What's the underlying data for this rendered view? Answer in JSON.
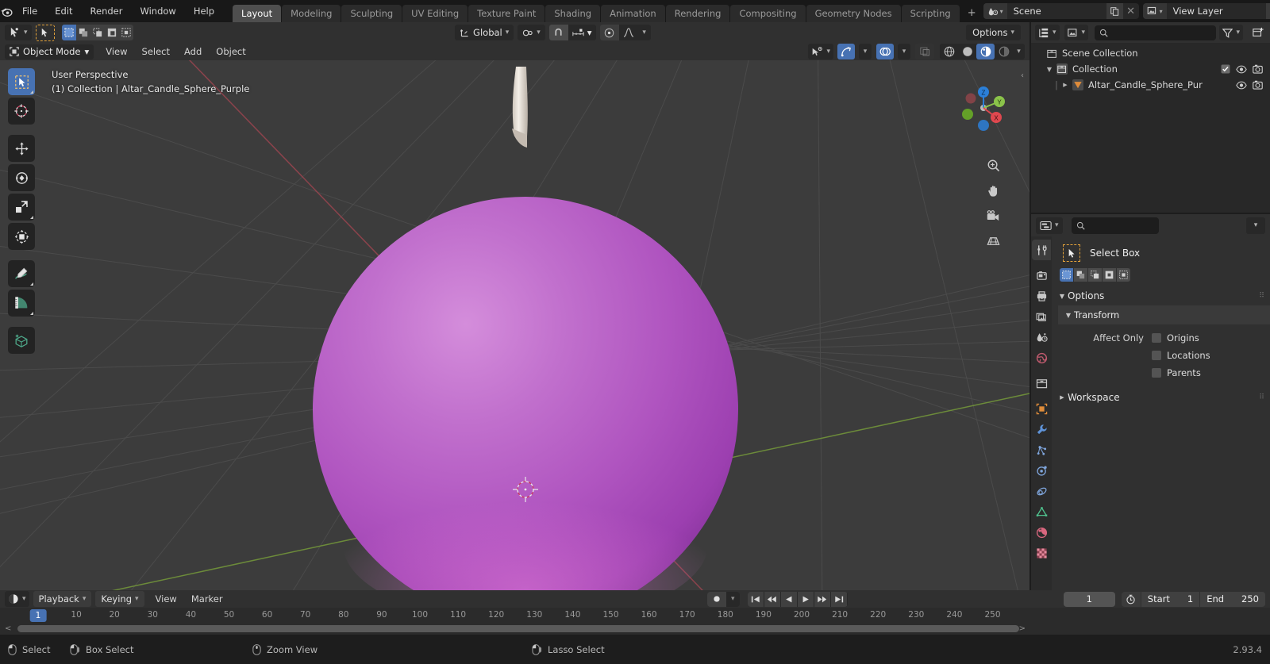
{
  "app": {
    "title": "Blender",
    "version": "2.93.4",
    "logo_icon": "blender-logo-icon"
  },
  "topbar": {
    "menus": [
      "File",
      "Edit",
      "Render",
      "Window",
      "Help"
    ],
    "workspace_tabs": [
      "Layout",
      "Modeling",
      "Sculpting",
      "UV Editing",
      "Texture Paint",
      "Shading",
      "Animation",
      "Rendering",
      "Compositing",
      "Geometry Nodes",
      "Scripting"
    ],
    "active_workspace": "Layout",
    "add_workspace_label": "+",
    "scene": {
      "icon": "scene-icon",
      "name": "Scene",
      "new_icon": "new-copy-icon",
      "unlink_icon": "close-x-icon"
    },
    "view_layer": {
      "icon": "view-layer-icon",
      "name": "View Layer",
      "new_icon": "new-copy-icon",
      "unlink_icon": "close-x-icon"
    }
  },
  "viewport_toolsettings": {
    "active_tool_icon": "cursor-tool-icon",
    "select_mode_icons": [
      "select-new-icon",
      "select-extend-icon",
      "select-subtract-icon",
      "select-invert-icon",
      "select-intersect-icon"
    ],
    "transform_orientation": {
      "icon": "orientation-icon",
      "value": "Global",
      "chevron": "v"
    },
    "pivot_point": {
      "icon": "pivot-icon",
      "chevron": "v"
    },
    "snap_magnet_icon": "magnet-icon",
    "snap_target": {
      "icon": "snap-increment-icon",
      "chevron": "v"
    },
    "proportional_edit_icon": "proportional-edit-icon",
    "falloff_icon": "falloff-curve-icon",
    "options_label": "Options",
    "options_chevron": "v"
  },
  "viewport_header": {
    "mode": {
      "icon": "object-mode-icon",
      "label": "Object Mode",
      "chevron": "v"
    },
    "menus": [
      "View",
      "Select",
      "Add",
      "Object"
    ],
    "right_controls": {
      "visibility": {
        "icon": "visibility-icon",
        "chevron": "v"
      },
      "gizmo": {
        "icon": "gizmo-icon",
        "chevron": "v",
        "active": true
      },
      "overlays": {
        "icon": "overlays-icon",
        "chevron": "v",
        "active": true
      },
      "xray_icon": "xray-icon",
      "shading_modes": [
        "wireframe-icon",
        "solid-icon",
        "material-preview-icon",
        "rendered-icon"
      ],
      "shading_active_index": 2,
      "shading_chevron": "v"
    }
  },
  "viewport": {
    "overlay_line1": "User Perspective",
    "overlay_line2": "(1) Collection | Altar_Candle_Sphere_Purple",
    "toolbar": [
      {
        "name": "tweak-select-box-tool",
        "icon": "select-box-icon",
        "selected": true
      },
      {
        "name": "cursor-tool",
        "icon": "cursor-3d-icon",
        "selected": false
      },
      {
        "name": "move-tool",
        "icon": "move-icon",
        "selected": false
      },
      {
        "name": "rotate-tool",
        "icon": "rotate-icon",
        "selected": false
      },
      {
        "name": "scale-tool",
        "icon": "scale-icon",
        "selected": false
      },
      {
        "name": "transform-tool",
        "icon": "transform-icon",
        "selected": false
      },
      {
        "name": "annotate-tool",
        "icon": "annotate-pencil-icon",
        "selected": false
      },
      {
        "name": "measure-tool",
        "icon": "measure-ruler-icon",
        "selected": false
      },
      {
        "name": "add-cube-tool",
        "icon": "add-cube-icon",
        "selected": false
      }
    ],
    "gizmo_axes": [
      {
        "label": "Z",
        "color": "#2b7fd8"
      },
      {
        "label": "Y",
        "color": "#8bc34a"
      },
      {
        "label": "X",
        "color": "#e0484f"
      }
    ],
    "nav_buttons": [
      "zoom-icon",
      "pan-hand-icon",
      "camera-icon",
      "ortho-persp-icon"
    ],
    "object": {
      "name": "Altar_Candle_Sphere_Purple",
      "body_color": "#b055c0",
      "body_highlight": "#cf86d6",
      "body_shadow": "#7d2f92",
      "wick_color": "#efe9e2"
    },
    "grid_color": "#585858",
    "axis_x_color": "#9b4c57",
    "axis_y_color": "#7aa02f",
    "background_color": "#3c3c3c",
    "origin_marker": "3d-cursor-icon"
  },
  "outliner": {
    "header": {
      "display_mode_icon": "outliner-display-icon",
      "filter_collection_icon": "collection-filter-icon",
      "search_icon": "search-icon",
      "search_placeholder": "",
      "filter_icon": "filter-funnel-icon",
      "new_collection_icon": "new-collection-icon"
    },
    "rows": [
      {
        "indent": 0,
        "triangle": "",
        "icon": "scene-collection-icon",
        "label": "Scene Collection",
        "checkbox": false,
        "eye": false,
        "camera": false
      },
      {
        "indent": 1,
        "triangle": "▼",
        "icon": "collection-icon",
        "label": "Collection",
        "checkbox": true,
        "eye": true,
        "camera": true
      },
      {
        "indent": 2,
        "triangle": "▶",
        "icon": "mesh-object-icon",
        "label": "Altar_Candle_Sphere_Pur",
        "checkbox": false,
        "eye": true,
        "camera": true
      }
    ]
  },
  "properties": {
    "header": {
      "editor_type_icon": "properties-editor-icon",
      "chevron": "v",
      "search_icon": "search-icon",
      "search_placeholder": "",
      "dropdown_chevron": "v"
    },
    "tabs": [
      {
        "name": "tool-tab",
        "icon": "tool-screwdriver-wrench-icon",
        "selected": true,
        "color": "#d0d0d0"
      },
      {
        "name": "render-tab",
        "icon": "render-camera-back-icon",
        "selected": false,
        "color": "#d0d0d0"
      },
      {
        "name": "output-tab",
        "icon": "output-printer-icon",
        "selected": false,
        "color": "#d0d0d0"
      },
      {
        "name": "view-layer-tab",
        "icon": "view-layer-images-icon",
        "selected": false,
        "color": "#d0d0d0"
      },
      {
        "name": "scene-tab",
        "icon": "scene-cone-icon",
        "selected": false,
        "color": "#d0d0d0"
      },
      {
        "name": "world-tab",
        "icon": "world-globe-icon",
        "selected": false,
        "color": "#c05a6e"
      },
      {
        "name": "collection-tab",
        "icon": "collection-box-icon",
        "selected": false,
        "color": "#d0d0d0"
      },
      {
        "name": "object-tab",
        "icon": "object-square-icon",
        "selected": false,
        "color": "#e08c3a"
      },
      {
        "name": "modifiers-tab",
        "icon": "modifier-wrench-icon",
        "selected": false,
        "color": "#5f93d8"
      },
      {
        "name": "particles-tab",
        "icon": "particles-icon",
        "selected": false,
        "color": "#7fa6dd"
      },
      {
        "name": "physics-tab",
        "icon": "physics-orbit-icon",
        "selected": false,
        "color": "#7fa6dd"
      },
      {
        "name": "constraints-tab",
        "icon": "constraints-icon",
        "selected": false,
        "color": "#7fa6dd"
      },
      {
        "name": "data-tab",
        "icon": "mesh-data-triangle-icon",
        "selected": false,
        "color": "#4fc08d"
      },
      {
        "name": "material-tab",
        "icon": "material-sphere-icon",
        "selected": false,
        "color": "#d9677f"
      },
      {
        "name": "texture-tab",
        "icon": "texture-checker-icon",
        "selected": false,
        "color": "#d9677f"
      }
    ],
    "active_tool": {
      "icon": "select-box-tool-icon",
      "label": "Select Box",
      "mode_icons": [
        "set-new-icon",
        "extend-icon",
        "subtract-icon",
        "invert-icon",
        "intersect-icon"
      ],
      "mode_active_index": 0
    },
    "panels": [
      {
        "name": "options-panel",
        "triangle": "▼",
        "label": "Options",
        "grip": "::::",
        "subpanels": [
          {
            "name": "transform-subpanel",
            "triangle": "▼",
            "label": "Transform",
            "rows_label": "Affect Only",
            "checkboxes": [
              {
                "label": "Origins",
                "checked": false
              },
              {
                "label": "Locations",
                "checked": false
              },
              {
                "label": "Parents",
                "checked": false
              }
            ]
          }
        ]
      },
      {
        "name": "workspace-panel",
        "triangle": "▶",
        "label": "Workspace",
        "grip": "::::",
        "subpanels": []
      }
    ]
  },
  "timeline": {
    "header": {
      "editor_icon": "timeline-editor-icon",
      "editor_chevron": "v",
      "menus": [
        {
          "label": "Playback",
          "chevron": "v"
        },
        {
          "label": "Keying",
          "chevron": "v"
        },
        {
          "label": "View",
          "chevron": ""
        },
        {
          "label": "Marker",
          "chevron": ""
        }
      ],
      "record_icon": "record-dot-icon",
      "record_chevron": "v",
      "transport": [
        "jump-to-start-icon",
        "prev-keyframe-icon",
        "play-reverse-icon",
        "play-icon",
        "next-keyframe-icon",
        "jump-to-end-icon"
      ],
      "current_frame": "1",
      "autokey_icon": "auto-keying-icon",
      "start_label": "Start",
      "start_value": "1",
      "end_label": "End",
      "end_value": "250"
    },
    "playhead_frame": "1",
    "ticks": [
      "10",
      "20",
      "30",
      "40",
      "50",
      "60",
      "70",
      "80",
      "90",
      "100",
      "110",
      "120",
      "130",
      "140",
      "150",
      "160",
      "170",
      "180",
      "190",
      "200",
      "210",
      "220",
      "230",
      "240",
      "250"
    ],
    "scroll_left_arrow": "<",
    "scroll_right_arrow": ">"
  },
  "statusbar": {
    "items": [
      {
        "icon": "mouse-left-icon",
        "label": "Select"
      },
      {
        "icon": "mouse-left-drag-icon",
        "label": "Box Select"
      },
      {
        "icon": "mouse-middle-icon",
        "label": "Zoom View"
      },
      {
        "icon": "mouse-ctrl-left-icon",
        "label": "Lasso Select"
      }
    ],
    "version": "2.93.4"
  },
  "colors": {
    "accent_blue": "#4772b3",
    "header_bg": "#303030",
    "editor_bg": "#282828",
    "topbar_bg": "#181818",
    "viewport_bg": "#3c3c3c",
    "object_purple": "#b055c0"
  }
}
